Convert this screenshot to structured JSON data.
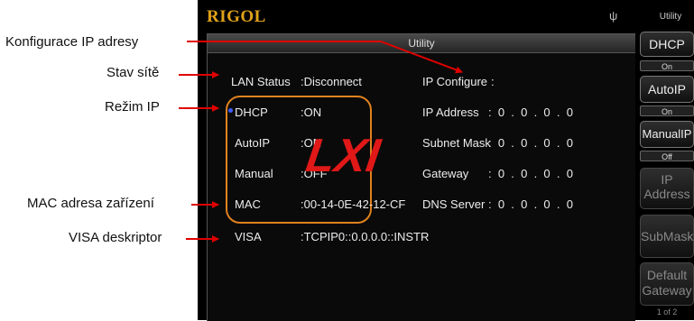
{
  "annotations": {
    "ip_config": "Konfigurace IP adresy",
    "network_status": "Stav sítě",
    "ip_mode": "Režim IP",
    "mac": "MAC adresa zařízení",
    "visa": "VISA deskriptor"
  },
  "screen": {
    "brand": "RIGOL",
    "usb_symbol": "ψ",
    "softkey_title": "Utility",
    "panel_title": "Utility"
  },
  "lan": {
    "status_label": "LAN Status",
    "status_value": ":Disconnect",
    "dhcp_label": "DHCP",
    "dhcp_value": ":ON",
    "autoip_label": "AutoIP",
    "autoip_value": ":ON",
    "manual_label": "Manual",
    "manual_value": ":OFF",
    "mac_label": "MAC",
    "mac_value": ":00-14-0E-42-12-CF",
    "visa_label": "VISA",
    "visa_value": ":TCPIP0::0.0.0.0::INSTR",
    "ip_configure_label": "IP Configure",
    "ip_configure_value": ":",
    "ip_address_label": "IP Address",
    "ip_address_value": ":  0  .  0  .  0  .  0",
    "subnet_label": "Subnet Mask",
    "subnet_value": ":  0  .  0  .  0  .  0",
    "gateway_label": "Gateway",
    "gateway_value": ":  0  .  0  .  0  .  0",
    "dns_label": "DNS Server",
    "dns_value": ":  0  .  0  .  0  .  0"
  },
  "logo": "LXI",
  "softkeys": {
    "dhcp": "DHCP",
    "dhcp_state": "On",
    "autoip": "AutoIP",
    "autoip_state": "On",
    "manualip": "ManualIP",
    "manualip_state": "Off",
    "ip_address_line1": "IP",
    "ip_address_line2": "Address",
    "submask": "SubMask",
    "default_line1": "Default",
    "default_line2": "Gateway",
    "page": "1 of 2"
  },
  "colors": {
    "brand": "#e0a21a",
    "highlight_box": "#e0821e",
    "arrow": "#e00000",
    "logo": "#e01818",
    "dhcp_indicator": "#3d5bff"
  }
}
